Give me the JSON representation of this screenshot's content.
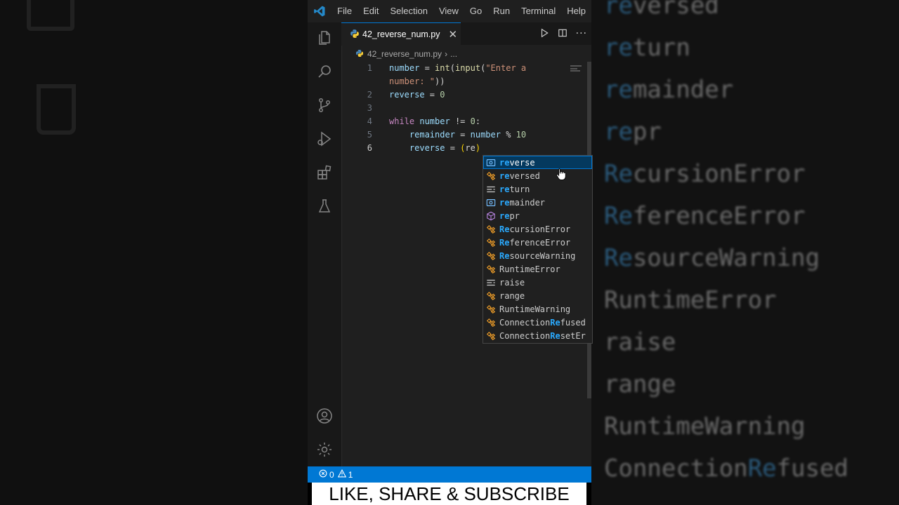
{
  "menu": [
    "File",
    "Edit",
    "Selection",
    "View",
    "Go",
    "Run",
    "Terminal",
    "Help"
  ],
  "tab": {
    "filename": "42_reverse_num.py"
  },
  "breadcrumb": {
    "file": "42_reverse_num.py",
    "ellipsis": "..."
  },
  "code_lines": [
    {
      "n": "1",
      "tokens": [
        [
          "var",
          "number"
        ],
        [
          "op",
          " = "
        ],
        [
          "fn",
          "int"
        ],
        [
          "op",
          "("
        ],
        [
          "fn",
          "input"
        ],
        [
          "op",
          "("
        ],
        [
          "str",
          "\"Enter a"
        ]
      ]
    },
    {
      "n": "",
      "tokens": [
        [
          "str",
          "number: \""
        ],
        [
          "op",
          "))"
        ]
      ]
    },
    {
      "n": "2",
      "tokens": [
        [
          "var",
          "reverse"
        ],
        [
          "op",
          " = "
        ],
        [
          "num",
          "0"
        ]
      ]
    },
    {
      "n": "3",
      "tokens": []
    },
    {
      "n": "4",
      "tokens": [
        [
          "kw",
          "while"
        ],
        [
          "op",
          " "
        ],
        [
          "var",
          "number"
        ],
        [
          "op",
          " != "
        ],
        [
          "num",
          "0"
        ],
        [
          "op",
          ":"
        ]
      ]
    },
    {
      "n": "5",
      "tokens": [
        [
          "op",
          "    "
        ],
        [
          "var",
          "remainder"
        ],
        [
          "op",
          " = "
        ],
        [
          "var",
          "number"
        ],
        [
          "op",
          " % "
        ],
        [
          "num",
          "10"
        ]
      ]
    },
    {
      "n": "6",
      "tokens": [
        [
          "op",
          "    "
        ],
        [
          "var",
          "reverse"
        ],
        [
          "op",
          " = "
        ],
        [
          "bracket",
          "("
        ],
        [
          "op",
          "re"
        ],
        [
          "bracket",
          ")"
        ]
      ]
    }
  ],
  "active_line": "6",
  "suggestions": [
    {
      "kind": "variable",
      "label": "reverse",
      "selected": true
    },
    {
      "kind": "class",
      "label": "reversed"
    },
    {
      "kind": "keyword",
      "label": "return"
    },
    {
      "kind": "variable",
      "label": "remainder"
    },
    {
      "kind": "function",
      "label": "repr"
    },
    {
      "kind": "class",
      "label": "RecursionError"
    },
    {
      "kind": "class",
      "label": "ReferenceError"
    },
    {
      "kind": "class",
      "label": "ResourceWarning"
    },
    {
      "kind": "class",
      "label": "RuntimeError"
    },
    {
      "kind": "keyword",
      "label": "raise"
    },
    {
      "kind": "class",
      "label": "range"
    },
    {
      "kind": "class",
      "label": "RuntimeWarning"
    },
    {
      "kind": "class",
      "label": "ConnectionRefused"
    },
    {
      "kind": "class",
      "label": "ConnectionResetEr"
    }
  ],
  "status": {
    "errors": "0",
    "warnings": "1"
  },
  "banner": "LIKE, SHARE & SUBSCRIBE",
  "background_words": [
    "reversed",
    "return",
    "remainder",
    "repr",
    "RecursionError",
    "ReferenceError",
    "ResourceWarning",
    "RuntimeError",
    "raise",
    "range",
    "RuntimeWarning",
    "ConnectionRefused"
  ],
  "colors": {
    "accent": "#0078d4",
    "match": "#2aaaff",
    "class_icon": "#ee9d28",
    "variable_icon": "#75beff",
    "function_icon": "#b180d7"
  }
}
